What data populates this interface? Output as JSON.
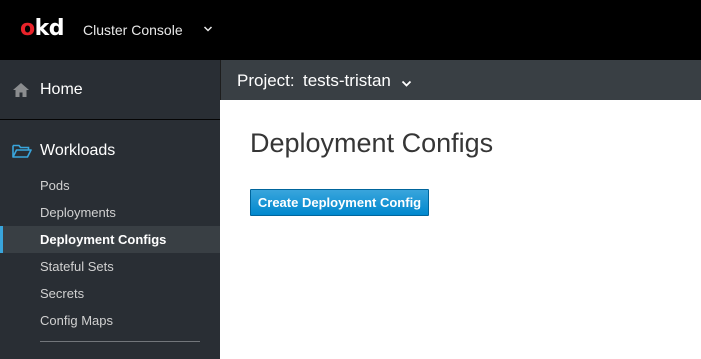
{
  "header": {
    "logo": {
      "o": "o",
      "kd": "kd",
      "colors": {
        "o": "#e8232a",
        "kd": "#ffffff"
      }
    },
    "switcher_label": "Cluster Console",
    "switcher_icon": "chevron-down-icon"
  },
  "sidebar": {
    "home": {
      "label": "Home",
      "icon": "home-icon"
    },
    "workloads": {
      "label": "Workloads",
      "icon": "folder-open-icon"
    },
    "items": [
      {
        "label": "Pods",
        "active": false
      },
      {
        "label": "Deployments",
        "active": false
      },
      {
        "label": "Deployment Configs",
        "active": true
      },
      {
        "label": "Stateful Sets",
        "active": false
      },
      {
        "label": "Secrets",
        "active": false
      },
      {
        "label": "Config Maps",
        "active": false
      }
    ]
  },
  "project_bar": {
    "label": "Project:",
    "name": "tests-tristan",
    "icon": "chevron-down-icon"
  },
  "main": {
    "title": "Deployment Configs",
    "create_button": "Create Deployment Config"
  },
  "colors": {
    "accent": "#0088ce",
    "active_indicator": "#39a5dc",
    "sidebar_bg": "#292e34",
    "masthead_bg": "#000000"
  }
}
